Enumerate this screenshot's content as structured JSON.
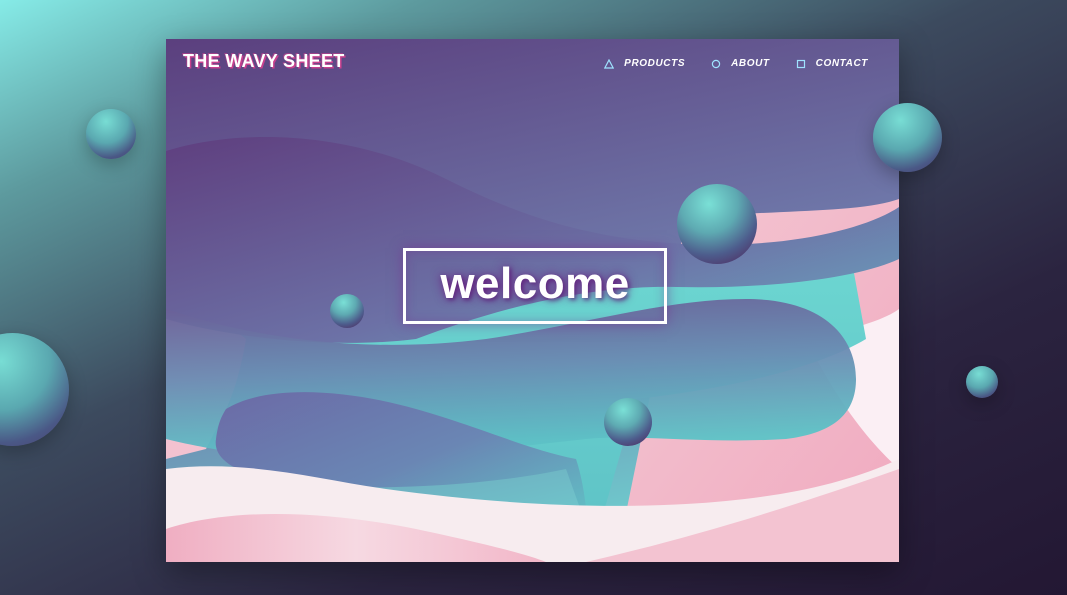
{
  "site": {
    "logo": "THE WAVY SHEET"
  },
  "nav": {
    "items": [
      {
        "label": "PRODUCTS",
        "icon": "triangle-icon"
      },
      {
        "label": "ABOUT",
        "icon": "circle-icon"
      },
      {
        "label": "CONTACT",
        "icon": "square-icon"
      }
    ]
  },
  "hero": {
    "welcome": "welcome"
  },
  "colors": {
    "teal": "#72d9d3",
    "purple": "#5e3a7a",
    "pink": "#f0b3c6",
    "white": "#ffffff",
    "logo_shadow": "#c8408e",
    "icon": "#9fe3ff"
  }
}
